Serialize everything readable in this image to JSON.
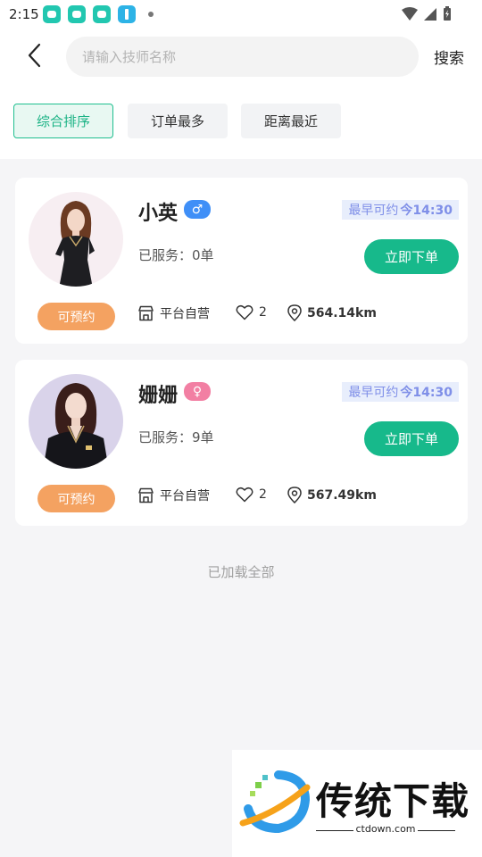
{
  "status_bar": {
    "time": "2:15"
  },
  "search": {
    "placeholder": "请输入技师名称",
    "button_label": "搜索"
  },
  "sort_tabs": [
    {
      "label": "综合排序",
      "active": true
    },
    {
      "label": "订单最多",
      "active": false
    },
    {
      "label": "距离最近",
      "active": false
    }
  ],
  "technicians": [
    {
      "name": "小英",
      "gender_symbol": "♂",
      "earliest_label": "最早可约",
      "earliest_time": "今14:30",
      "served_label": "已服务：",
      "served_count": "0单",
      "order_label": "立即下单",
      "available_label": "可预约",
      "shop_label": "平台自营",
      "likes": "2",
      "distance": "564.14km"
    },
    {
      "name": "姗姗",
      "gender_symbol": "♀",
      "earliest_label": "最早可约",
      "earliest_time": "今14:30",
      "served_label": "已服务：",
      "served_count": "9单",
      "order_label": "立即下单",
      "available_label": "可预约",
      "shop_label": "平台自营",
      "likes": "2",
      "distance": "567.49km"
    }
  ],
  "footer": {
    "loaded_all": "已加载全部"
  },
  "watermark": {
    "title": "传统下载",
    "subtitle": "ctdown.com"
  },
  "colors": {
    "accent_green": "#17b98b",
    "orange": "#f4a261",
    "male_blue": "#3f8ff7",
    "female_pink": "#f27fa3",
    "time_tag": "#7f8fe8"
  }
}
